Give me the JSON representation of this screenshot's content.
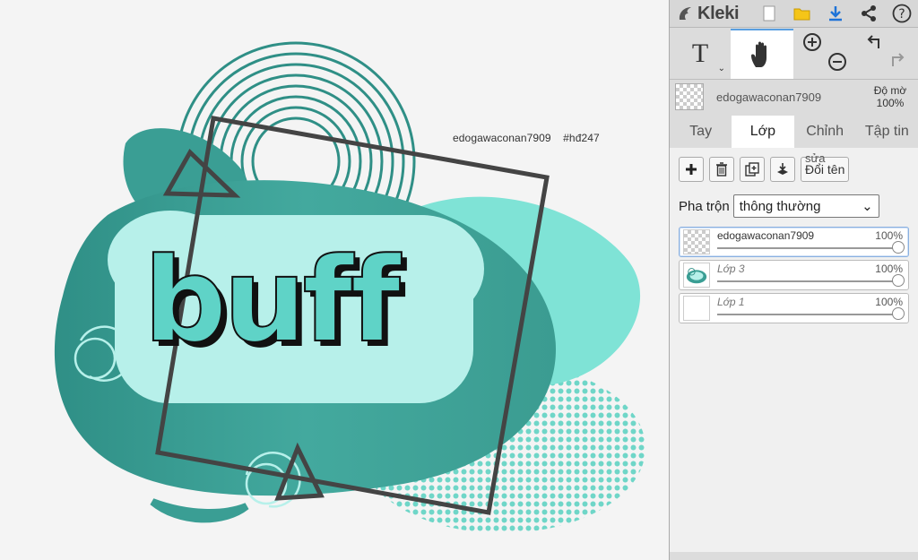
{
  "app": {
    "name": "Kleki"
  },
  "artwork": {
    "main_text": "buff",
    "caption_user": "edogawaconan7909",
    "caption_tag": "#hđ247",
    "colors": {
      "teal": "#3a9e94",
      "mint": "#7fe3d6",
      "pale": "#b7f0ea",
      "frame": "#444444"
    }
  },
  "toolbar": {
    "text_tool": "T",
    "text_tool_chevron": "⌄"
  },
  "layer_info": {
    "name": "edogawaconan7909",
    "opacity_label": "Độ mờ",
    "opacity_value": "100%"
  },
  "tabs": [
    {
      "label": "Tay",
      "active": false
    },
    {
      "label": "Lớp",
      "active": true
    },
    {
      "label": "Chỉnh",
      "active": false
    },
    {
      "label": "Tập tin",
      "active": false
    }
  ],
  "layer_panel": {
    "rename_small": "sửa",
    "rename_label": "Đổi tên",
    "blend_label": "Pha trộn",
    "blend_value": "thông thường",
    "blend_arrow": "⌄"
  },
  "layers": [
    {
      "name": "edogawaconan7909",
      "opacity": "100%",
      "opacity_fraction": 1.0,
      "selected": true,
      "thumb": "checker"
    },
    {
      "name": "Lớp 3",
      "opacity": "100%",
      "opacity_fraction": 1.0,
      "selected": false,
      "thumb": "art"
    },
    {
      "name": "Lớp 1",
      "opacity": "100%",
      "opacity_fraction": 1.0,
      "selected": false,
      "thumb": "white"
    }
  ]
}
